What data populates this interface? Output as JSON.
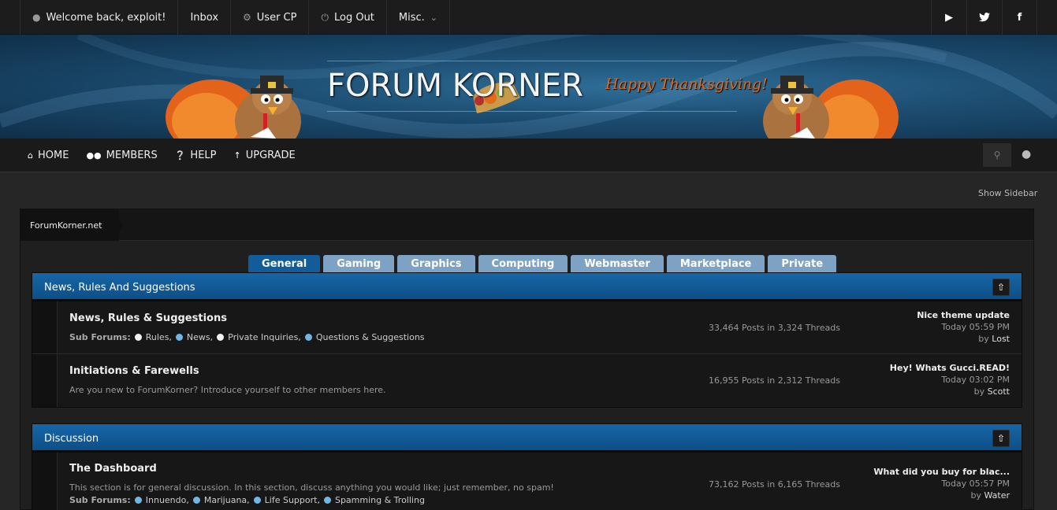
{
  "topbar": {
    "items": [
      {
        "icon": "user-icon",
        "label": "Welcome back, exploit!"
      },
      {
        "icon": "",
        "label": "Inbox"
      },
      {
        "icon": "gear-icon",
        "label": "User CP"
      },
      {
        "icon": "power-icon",
        "label": "Log Out"
      },
      {
        "icon": "chevron-down-icon",
        "label": "Misc."
      }
    ],
    "social": [
      "youtube-icon",
      "twitter-icon",
      "facebook-icon"
    ]
  },
  "banner": {
    "logo_text": "FORUM KORNER",
    "tagline": "Happy Thanksgiving!"
  },
  "nav": {
    "links": [
      {
        "icon": "home-icon",
        "label": "HOME"
      },
      {
        "icon": "members-icon",
        "label": "MEMBERS"
      },
      {
        "icon": "help-icon",
        "label": "HELP"
      },
      {
        "icon": "upgrade-icon",
        "label": "UPGRADE"
      }
    ],
    "search_icon": "search-icon",
    "theme_icon": "lightbulb-icon"
  },
  "sidebar_toggle": "Show Sidebar",
  "breadcrumb": "ForumKorner.net",
  "tabs": [
    "General",
    "Gaming",
    "Graphics",
    "Computing",
    "Webmaster",
    "Marketplace",
    "Private"
  ],
  "active_tab": "General",
  "categories": [
    {
      "title": "News, Rules And Suggestions",
      "forums": [
        {
          "name": "News, Rules & Suggestions",
          "sub_label": "Sub Forums:",
          "subforums": [
            {
              "name": "Rules,",
              "dot": "white"
            },
            {
              "name": "News,",
              "dot": "blue"
            },
            {
              "name": "Private Inquiries,",
              "dot": "white"
            },
            {
              "name": "Questions & Suggestions",
              "dot": "blue"
            }
          ],
          "stats": "33,464 Posts in 3,324 Threads",
          "last_title": "Nice theme update",
          "last_time": "Today 05:59 PM",
          "last_by": "by",
          "last_user": "Lost"
        },
        {
          "name": "Initiations & Farewells",
          "description": "Are you new to ForumKorner? Introduce yourself to other members here.",
          "stats": "16,955 Posts in 2,312 Threads",
          "last_title": "Hey! Whats Gucci.READ!",
          "last_time": "Today 03:02 PM",
          "last_by": "by",
          "last_user": "Scott"
        }
      ]
    },
    {
      "title": "Discussion",
      "forums": [
        {
          "name": "The Dashboard",
          "description": "This section is for general discussion. In this section, discuss anything you would like; just remember, no spam!",
          "sub_label": "Sub Forums:",
          "subforums": [
            {
              "name": "Innuendo,",
              "dot": "blue"
            },
            {
              "name": "Marijuana,",
              "dot": "blue"
            },
            {
              "name": "Life Support,",
              "dot": "blue"
            },
            {
              "name": "Spamming & Trolling",
              "dot": "blue"
            }
          ],
          "stats": "73,162 Posts in 6,165 Threads",
          "last_title": "What did you buy for blac...",
          "last_time": "Today 05:57 PM",
          "last_by": "by",
          "last_user": "Water"
        }
      ]
    }
  ]
}
